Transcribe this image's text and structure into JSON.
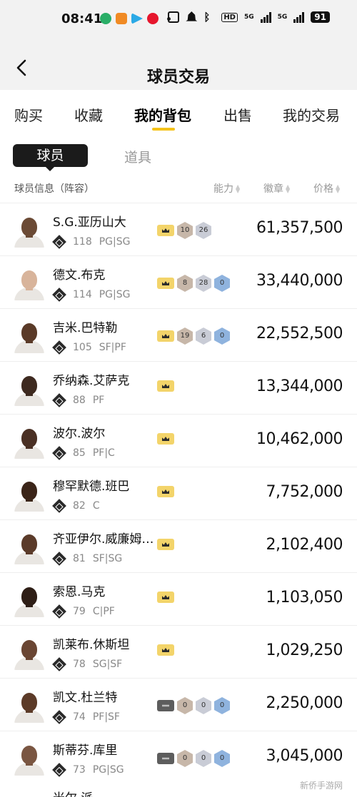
{
  "status_bar": {
    "time": "08:41",
    "network_5g_1": "5G",
    "network_5g_2": "5G",
    "hd": "HD",
    "battery": "91"
  },
  "header": {
    "title": "球员交易"
  },
  "tabs": [
    {
      "label": "购买"
    },
    {
      "label": "收藏"
    },
    {
      "label": "我的背包"
    },
    {
      "label": "出售"
    },
    {
      "label": "我的交易"
    }
  ],
  "segments": {
    "active": "球员",
    "other": "道具"
  },
  "columns": {
    "info": "球员信息（阵容）",
    "ability": "能力",
    "badge": "徽章",
    "price": "价格"
  },
  "players": [
    {
      "name": "S.G.亚历山大",
      "ovr": "118",
      "pos": "PG|SG",
      "crown": "gold",
      "badges": [
        {
          "v": "10",
          "t": "bronze"
        },
        {
          "v": "26",
          "t": "silver"
        }
      ],
      "price": "61,357,500",
      "skin": "#6b4a35"
    },
    {
      "name": "德文.布克",
      "ovr": "114",
      "pos": "PG|SG",
      "crown": "gold",
      "badges": [
        {
          "v": "8",
          "t": "bronze"
        },
        {
          "v": "28",
          "t": "silver"
        },
        {
          "v": "0",
          "t": "blue"
        }
      ],
      "price": "33,440,000",
      "skin": "#d8b49b"
    },
    {
      "name": "吉米.巴特勒",
      "ovr": "105",
      "pos": "SF|PF",
      "crown": "gold",
      "badges": [
        {
          "v": "19",
          "t": "bronze"
        },
        {
          "v": "6",
          "t": "silver"
        },
        {
          "v": "0",
          "t": "blue"
        }
      ],
      "price": "22,552,500",
      "skin": "#5a3a28"
    },
    {
      "name": "乔纳森.艾萨克",
      "ovr": "88",
      "pos": "PF",
      "crown": "gold",
      "badges": [],
      "price": "13,344,000",
      "skin": "#3e2a20"
    },
    {
      "name": "波尔.波尔",
      "ovr": "85",
      "pos": "PF|C",
      "crown": "gold",
      "badges": [],
      "price": "10,462,000",
      "skin": "#4a3024"
    },
    {
      "name": "穆罕默德.班巴",
      "ovr": "82",
      "pos": "C",
      "crown": "gold",
      "badges": [],
      "price": "7,752,000",
      "skin": "#3b2519"
    },
    {
      "name": "齐亚伊尔.威廉姆…",
      "ovr": "81",
      "pos": "SF|SG",
      "crown": "gold",
      "badges": [],
      "price": "2,102,400",
      "skin": "#5b3b2a"
    },
    {
      "name": "索恩.马克",
      "ovr": "79",
      "pos": "C|PF",
      "crown": "gold",
      "badges": [],
      "price": "1,103,050",
      "skin": "#2e1e16"
    },
    {
      "name": "凯莱布.休斯坦",
      "ovr": "78",
      "pos": "SG|SF",
      "crown": "gold",
      "badges": [],
      "price": "1,029,250",
      "skin": "#6a4633"
    },
    {
      "name": "凯文.杜兰特",
      "ovr": "74",
      "pos": "PF|SF",
      "crown": "dark",
      "badges": [
        {
          "v": "0",
          "t": "bronze"
        },
        {
          "v": "0",
          "t": "silver"
        },
        {
          "v": "0",
          "t": "blue"
        }
      ],
      "price": "2,250,000",
      "skin": "#5c3b28"
    },
    {
      "name": "斯蒂芬.库里",
      "ovr": "73",
      "pos": "PG|SG",
      "crown": "dark",
      "badges": [
        {
          "v": "0",
          "t": "bronze"
        },
        {
          "v": "0",
          "t": "silver"
        },
        {
          "v": "0",
          "t": "blue"
        }
      ],
      "price": "3,045,000",
      "skin": "#7a5642"
    }
  ],
  "partial_next_row": "米尔.派",
  "watermark": "新侨手游网",
  "colors": {
    "accent": "#f4c21a",
    "segment_active_bg": "#1b1b1b",
    "header_bg": "#f2f2f2"
  }
}
